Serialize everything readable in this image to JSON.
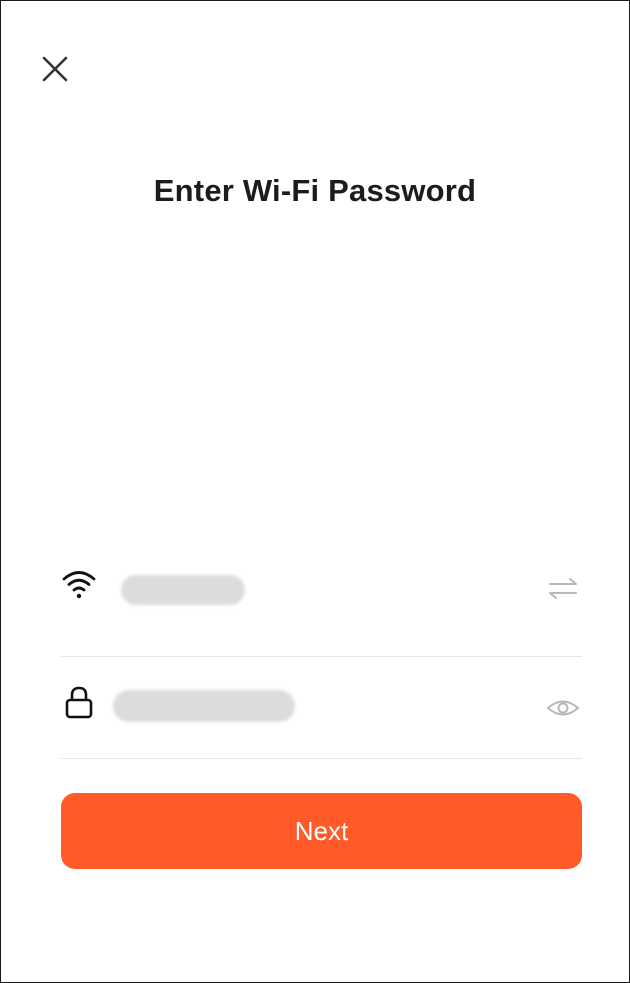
{
  "header": {
    "close_icon": "close-icon",
    "title": "Enter Wi-Fi Password"
  },
  "form": {
    "ssid": {
      "icon": "wifi-icon",
      "value": "",
      "trailing_icon": "switch-network-icon"
    },
    "password": {
      "icon": "lock-icon",
      "value": "",
      "trailing_icon": "eye-icon"
    }
  },
  "actions": {
    "next_label": "Next",
    "next_color": "#ff5a28"
  }
}
